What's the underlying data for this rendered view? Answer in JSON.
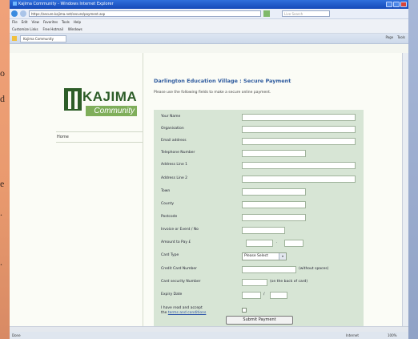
{
  "browser": {
    "title": "Kajima Community - Windows Internet Explorer",
    "address": "https://secure.kajima.net/secure/payment.asp",
    "search_placeholder": "Live Search",
    "menu": [
      "File",
      "Edit",
      "View",
      "Favorites",
      "Tools",
      "Help"
    ],
    "links": [
      "Customize Links",
      "Free Hotmail",
      "Windows"
    ],
    "tab_label": "Kajima Community",
    "tools": [
      "Page",
      "Tools"
    ],
    "status_left": "Done",
    "status_zone": "Internet",
    "status_zoom": "100%"
  },
  "edge_text": [
    "o",
    "d",
    "e",
    ".",
    "."
  ],
  "sidebar": {
    "logo_word": "KAJIMA",
    "logo_sub": "Community",
    "home": "Home"
  },
  "page": {
    "title": "Darlington Education Village : Secure Payment",
    "intro": "Please use the following fields to make a secure online payment."
  },
  "form": {
    "fields": {
      "name": "Your Name",
      "organisation": "Organisation",
      "email": "Email address",
      "telephone": "Telephone Number",
      "address1": "Address Line 1",
      "address2": "Address Line 2",
      "town": "Town",
      "county": "County",
      "postcode": "Postcode",
      "invoice": "Invoice or Event / No",
      "amount": "Amount to Pay £",
      "card_type": "Card Type",
      "card_number": "Credit Card Number",
      "security": "Card security Number",
      "expiry": "Expiry Date"
    },
    "amount_sep": ".",
    "card_type_value": "Please Select",
    "card_number_note": "(without spaces)",
    "security_note": "(on the back of card)",
    "expiry_sep": "/",
    "terms_line1": "I have read and accept",
    "terms_prefix": "the ",
    "terms_link": "terms and conditions",
    "submit": "Submit Payment"
  },
  "colors": {
    "accent": "#2d5a9e",
    "brand": "#2d5d28",
    "form_bg": "#d7e5d5"
  }
}
